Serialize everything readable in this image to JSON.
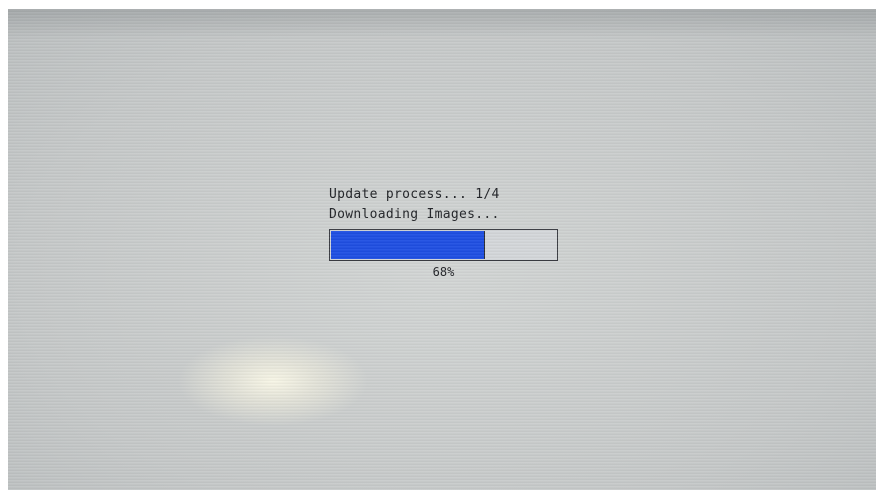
{
  "screen": {
    "status_line": "Update process... 1/4",
    "task_line": "Downloading Images...",
    "progress": {
      "value_percent": 68,
      "label": "68%",
      "fill_color": "#1f4fe3",
      "track_color": "#d4d7da"
    }
  }
}
